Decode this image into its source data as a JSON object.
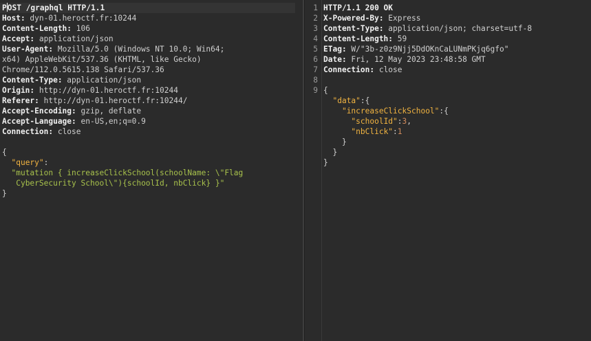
{
  "request": {
    "request_line": "POST /graphql HTTP/1.1",
    "request_line_rest": "OST /graphql HTTP/1.1",
    "request_line_first": "P",
    "headers": [
      {
        "name": "Host:",
        "value": " dyn-01.heroctf.fr:10244"
      },
      {
        "name": "Content-Length:",
        "value": " 106"
      },
      {
        "name": "Accept:",
        "value": " application/json"
      },
      {
        "name": "User-Agent:",
        "value": " Mozilla/5.0 (Windows NT 10.0; Win64;"
      },
      {
        "name": "",
        "value": "x64) AppleWebKit/537.36 (KHTML, like Gecko)"
      },
      {
        "name": "",
        "value": "Chrome/112.0.5615.138 Safari/537.36"
      },
      {
        "name": "Content-Type:",
        "value": " application/json"
      },
      {
        "name": "Origin:",
        "value": " http://dyn-01.heroctf.fr:10244"
      },
      {
        "name": "Referer:",
        "value": " http://dyn-01.heroctf.fr:10244/"
      },
      {
        "name": "Accept-Encoding:",
        "value": " gzip, deflate"
      },
      {
        "name": "Accept-Language:",
        "value": " en-US,en;q=0.9"
      },
      {
        "name": "Connection:",
        "value": " close"
      }
    ],
    "body": {
      "open_brace": "{",
      "query_key": "\"query\"",
      "colon": ":",
      "query_value_line1": "\"mutation { increaseClickSchool(schoolName: \\\"Flag",
      "query_value_line2": " CyberSecurity School\\\"){schoolId, nbClick} }\"",
      "close_brace": "}"
    }
  },
  "response": {
    "line_numbers": [
      "1",
      "2",
      "3",
      "4",
      "5",
      "6",
      "7",
      "8",
      "9"
    ],
    "status_line": "HTTP/1.1 200 OK",
    "headers": [
      {
        "name": "X-Powered-By:",
        "value": " Express"
      },
      {
        "name": "Content-Type:",
        "value": " application/json; charset=utf-8"
      },
      {
        "name": "Content-Length:",
        "value": " 59"
      },
      {
        "name": "ETag:",
        "value": " W/\"3b-z0z9Njj5DdOKnCaLUNmPKjq6gfo\""
      },
      {
        "name": "Date:",
        "value": " Fri, 12 May 2023 23:48:58 GMT"
      },
      {
        "name": "Connection:",
        "value": " close"
      }
    ],
    "body": {
      "open_brace": "{",
      "data_key": "\"data\"",
      "data_open": ":{",
      "icks_key": "\"increaseClickSchool\"",
      "icks_open": ":{",
      "school_key": "\"schoolId\"",
      "school_colon": ":",
      "school_val": "3",
      "school_comma": ",",
      "nb_key": "\"nbClick\"",
      "nb_colon": ":",
      "nb_val": "1",
      "inner_close": "}",
      "mid_close": "}",
      "outer_close": "}"
    }
  },
  "colors": {
    "background": "#2b2b2b",
    "json_key": "#f2b441",
    "json_string": "#a8c24c",
    "json_number": "#d18b5c",
    "accent": "#d86b3a"
  }
}
